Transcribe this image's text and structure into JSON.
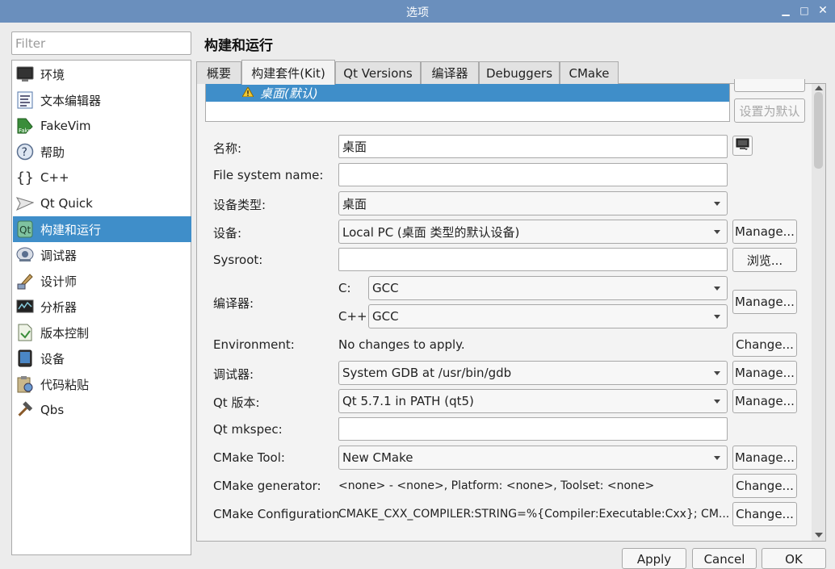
{
  "window": {
    "title": "选项",
    "minimize": "▁",
    "maximize": "□",
    "close": "✕"
  },
  "filter": {
    "placeholder": "Filter",
    "value": ""
  },
  "sidebar": {
    "items": [
      {
        "label": "环境",
        "icon": "monitor-icon"
      },
      {
        "label": "文本编辑器",
        "icon": "text-editor-icon"
      },
      {
        "label": "FakeVim",
        "icon": "fakevim-icon"
      },
      {
        "label": "帮助",
        "icon": "help-icon"
      },
      {
        "label": "C++",
        "icon": "braces-icon"
      },
      {
        "label": "Qt Quick",
        "icon": "paper-plane-icon"
      },
      {
        "label": "构建和运行",
        "icon": "build-run-icon",
        "selected": true
      },
      {
        "label": "调试器",
        "icon": "debugger-icon"
      },
      {
        "label": "设计师",
        "icon": "designer-icon"
      },
      {
        "label": "分析器",
        "icon": "analyzer-icon"
      },
      {
        "label": "版本控制",
        "icon": "version-control-icon"
      },
      {
        "label": "设备",
        "icon": "device-icon"
      },
      {
        "label": "代码粘贴",
        "icon": "code-paste-icon"
      },
      {
        "label": "Qbs",
        "icon": "hammer-icon"
      }
    ]
  },
  "page": {
    "title": "构建和运行"
  },
  "tabs": [
    {
      "label": "概要"
    },
    {
      "label": "构建套件(Kit)",
      "active": true
    },
    {
      "label": "Qt Versions"
    },
    {
      "label": "编译器"
    },
    {
      "label": "Debuggers"
    },
    {
      "label": "CMake"
    }
  ],
  "kit_list": {
    "selected_kit": "桌面(默认)",
    "warning_icon": "warning-icon"
  },
  "kit_buttons": {
    "make_default": "设置为默认"
  },
  "form": {
    "name": {
      "label": "名称:",
      "value": "桌面"
    },
    "file_system_name": {
      "label": "File system name:",
      "value": ""
    },
    "device_type": {
      "label": "设备类型:",
      "value": "桌面"
    },
    "device": {
      "label": "设备:",
      "value": "Local PC (桌面 类型的默认设备)",
      "button": "Manage..."
    },
    "sysroot": {
      "label": "Sysroot:",
      "value": "",
      "button": "浏览..."
    },
    "compiler": {
      "label": "编译器:",
      "c_label": "C:",
      "c_value": "GCC",
      "cpp_label": "C++:",
      "cpp_value": "GCC",
      "button": "Manage..."
    },
    "environment": {
      "label": "Environment:",
      "value": "No changes to apply.",
      "button": "Change..."
    },
    "debugger": {
      "label": "调试器:",
      "value": "System GDB at /usr/bin/gdb",
      "button": "Manage..."
    },
    "qt_version": {
      "label": "Qt 版本:",
      "value": "Qt 5.7.1 in PATH (qt5)",
      "button": "Manage..."
    },
    "qt_mkspec": {
      "label": "Qt mkspec:",
      "value": ""
    },
    "cmake_tool": {
      "label": "CMake Tool:",
      "value": "New CMake",
      "button": "Manage..."
    },
    "cmake_generator": {
      "label": "CMake generator:",
      "value": "<none> - <none>, Platform: <none>, Toolset: <none>",
      "button": "Change..."
    },
    "cmake_configuration": {
      "label": "CMake Configuration",
      "value": "CMAKE_CXX_COMPILER:STRING=%{Compiler:Executable:Cxx}; CM...",
      "button": "Change..."
    }
  },
  "bottom": {
    "apply": "Apply",
    "cancel": "Cancel",
    "ok": "OK"
  }
}
